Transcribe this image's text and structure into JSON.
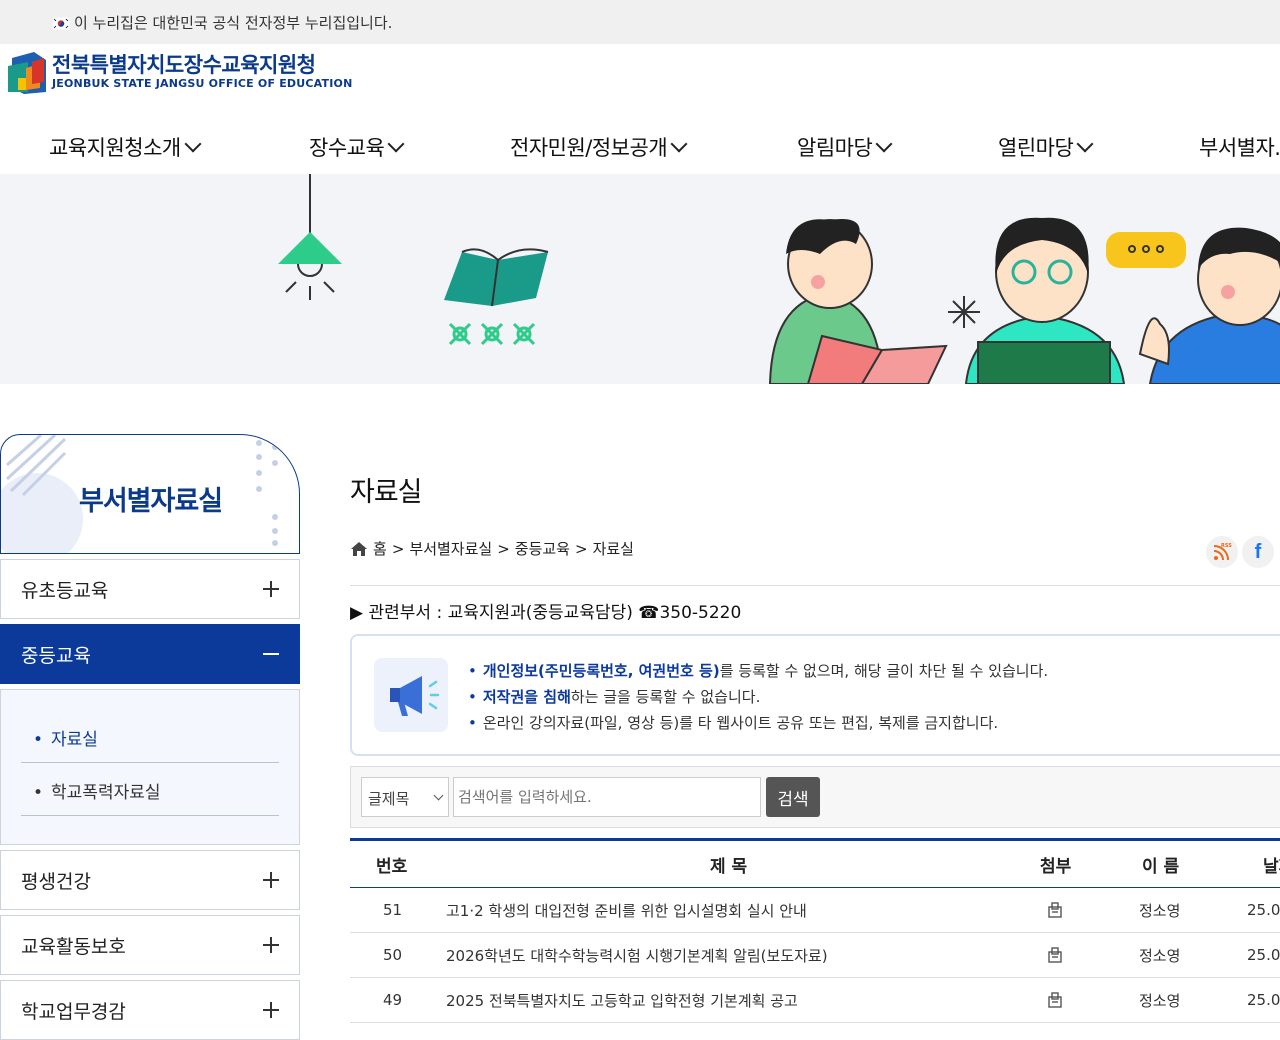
{
  "gov_bar": {
    "text": "이 누리집은 대한민국 공식 전자정부 누리집입니다."
  },
  "logo": {
    "ko": "전북특별자치도장수교육지원청",
    "en": "JEONBUK STATE JANGSU OFFICE OF EDUCATION"
  },
  "gnb": [
    {
      "label": "교육지원청소개"
    },
    {
      "label": "장수교육"
    },
    {
      "label": "전자민원/정보공개"
    },
    {
      "label": "알림마당"
    },
    {
      "label": "열린마당"
    },
    {
      "label": "부서별자."
    }
  ],
  "lnb": {
    "title": "부서별자료실",
    "items": [
      {
        "label": "유초등교육"
      },
      {
        "label": "중등교육"
      },
      {
        "label": "평생건강"
      },
      {
        "label": "교육활동보호"
      },
      {
        "label": "학교업무경감"
      }
    ],
    "sub_items": [
      {
        "label": "자료실"
      },
      {
        "label": "학교폭력자료실"
      }
    ]
  },
  "page": {
    "title": "자료실",
    "breadcrumb": [
      "홈",
      "부서별자료실",
      "중등교육",
      "자료실"
    ],
    "dept": "▶ 관련부서 : 교육지원과(중등교육담당) ☎350-5220",
    "rss": "RSS",
    "facebook": "f"
  },
  "notice": {
    "line1_bold": "개인정보(주민등록번호, 여권번호 등)",
    "line1_rest": "를 등록할 수 없으며, 해당 글이 차단 될 수 있습니다.",
    "line2_bold": "저작권을 침해",
    "line2_rest": "하는 글을 등록할 수 없습니다.",
    "line3": "온라인 강의자료(파일, 영상 등)를 타 웹사이트 공유 또는 편집, 복제를 금지합니다."
  },
  "search": {
    "select": "글제목",
    "placeholder": "검색어를 입력하세요.",
    "button": "검색"
  },
  "table": {
    "headers": {
      "no": "번호",
      "title": "제 목",
      "attach": "첨부",
      "name": "이 름",
      "date": "날짜"
    },
    "rows": [
      {
        "no": "51",
        "title": "고1·2 학생의 대입전형 준비를 위한 입시설명회 실시 안내",
        "name": "정소영",
        "date": "25.0"
      },
      {
        "no": "50",
        "title": "2026학년도 대학수학능력시험 시행기본계획 알림(보도자료)",
        "name": "정소영",
        "date": "25.0"
      },
      {
        "no": "49",
        "title": "2025 전북특별자치도 고등학교 입학전형 기본계획 공고",
        "name": "정소영",
        "date": "25.0"
      }
    ]
  },
  "colors": {
    "brand": "#0b3a9a",
    "banner_bg": "#f3f4f7"
  }
}
